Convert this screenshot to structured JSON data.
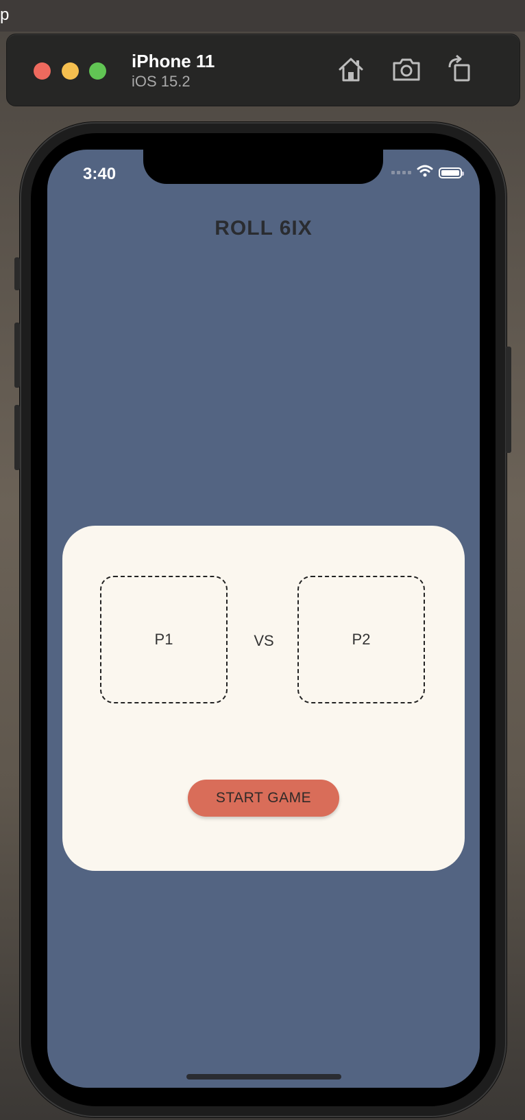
{
  "top_strip": {
    "app_letter": "p"
  },
  "simulator": {
    "device_name": "iPhone 11",
    "os_version": "iOS 15.2",
    "tools": [
      "home-icon",
      "screenshot-icon",
      "rotate-icon"
    ]
  },
  "status_bar": {
    "time": "3:40"
  },
  "app": {
    "title": "ROLL 6IX",
    "player_one": "P1",
    "versus": "VS",
    "player_two": "P2",
    "start_button": "START GAME"
  },
  "colors": {
    "screen_bg": "#536482",
    "card_bg": "#fbf7ef",
    "button_bg": "#d96d59"
  }
}
